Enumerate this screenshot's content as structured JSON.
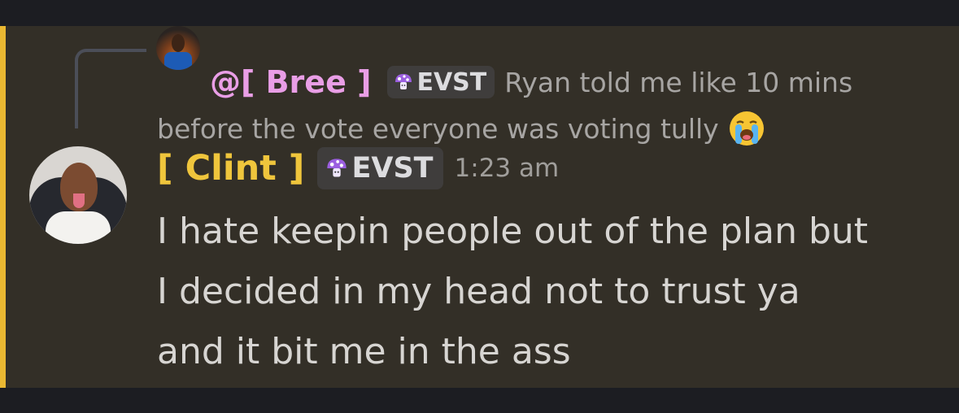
{
  "reply": {
    "author": "@[ Bree ]",
    "badge": "EVST",
    "text_line1": "Ryan told me like 10 mins",
    "text_line2": "before the vote everyone was voting tully",
    "emoji": "loudly-crying-face"
  },
  "message": {
    "author": "[ Clint ]",
    "badge": "EVST",
    "timestamp": "1:23 am",
    "text": "I hate keepin people out of the plan but\nI decided in my head not to trust ya\nand it bit me in the ass"
  },
  "colors": {
    "background": "#1c1d22",
    "message_highlight": "#332f27",
    "mention_bar": "#eab832",
    "reply_author": "#e99ee6",
    "author": "#efc53c",
    "badge_bg": "#3f3d3c",
    "mushroom": "#9b5fe0"
  },
  "icons": {
    "badge_icon": "purple-mushroom-icon"
  }
}
